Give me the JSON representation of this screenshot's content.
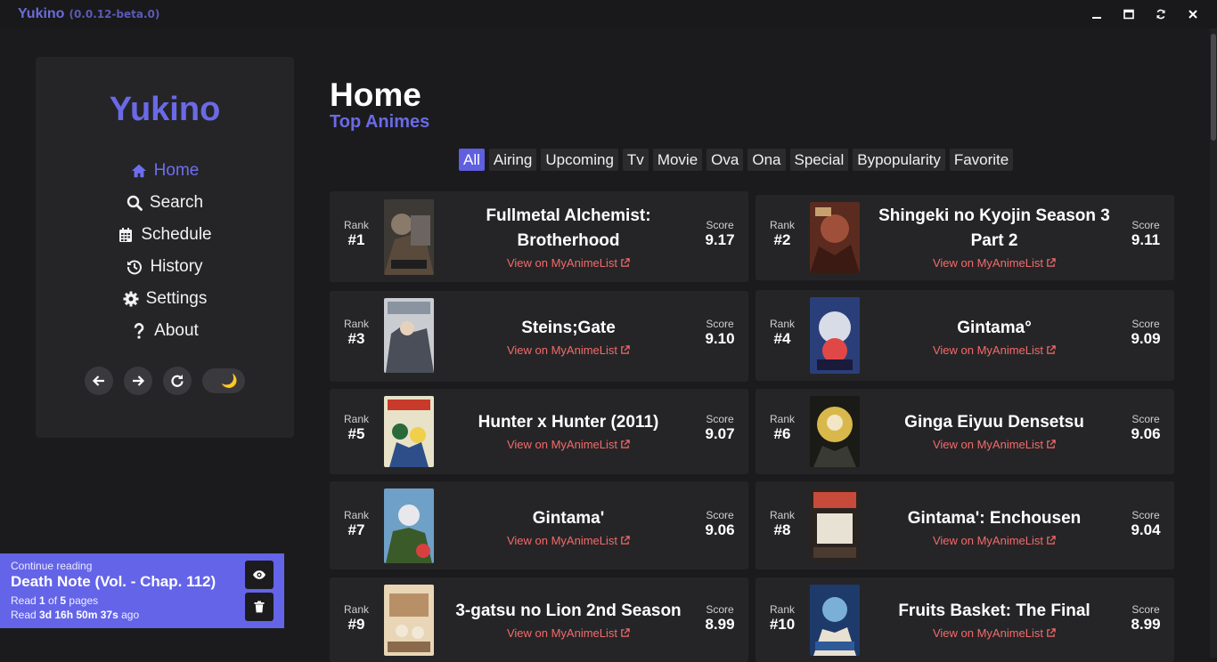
{
  "window": {
    "app_name": "Yukino",
    "version": "(0.0.12-beta.0)",
    "controls": [
      "minimize-icon",
      "maximize-icon",
      "reload-icon",
      "close-icon"
    ]
  },
  "sidebar": {
    "brand": "Yukino",
    "items": [
      {
        "label": "Home",
        "icon": "home-icon",
        "active": true
      },
      {
        "label": "Search",
        "icon": "search-icon",
        "active": false
      },
      {
        "label": "Schedule",
        "icon": "calendar-icon",
        "active": false
      },
      {
        "label": "History",
        "icon": "history-icon",
        "active": false
      },
      {
        "label": "Settings",
        "icon": "gear-icon",
        "active": false
      },
      {
        "label": "About",
        "icon": "question-icon",
        "active": false
      }
    ],
    "theme_icon": "🌙"
  },
  "header": {
    "title": "Home",
    "subtitle": "Top Animes"
  },
  "filters": [
    "All",
    "Airing",
    "Upcoming",
    "Tv",
    "Movie",
    "Ova",
    "Ona",
    "Special",
    "Bypopularity",
    "Favorite"
  ],
  "active_filter": "All",
  "labels": {
    "rank": "Rank",
    "score": "Score",
    "link": "View on MyAnimeList"
  },
  "animes": [
    {
      "rank": "#1",
      "title": "Fullmetal Alchemist: Brotherhood",
      "score": "9.17"
    },
    {
      "rank": "#2",
      "title": "Shingeki no Kyojin Season 3 Part 2",
      "score": "9.11"
    },
    {
      "rank": "#3",
      "title": "Steins;Gate",
      "score": "9.10"
    },
    {
      "rank": "#4",
      "title": "Gintama°",
      "score": "9.09"
    },
    {
      "rank": "#5",
      "title": "Hunter x Hunter (2011)",
      "score": "9.07"
    },
    {
      "rank": "#6",
      "title": "Ginga Eiyuu Densetsu",
      "score": "9.06"
    },
    {
      "rank": "#7",
      "title": "Gintama'",
      "score": "9.06"
    },
    {
      "rank": "#8",
      "title": "Gintama': Enchousen",
      "score": "9.04"
    },
    {
      "rank": "#9",
      "title": "3-gatsu no Lion 2nd Season",
      "score": "8.99"
    },
    {
      "rank": "#10",
      "title": "Fruits Basket: The Final",
      "score": "8.99"
    }
  ],
  "continue_reading": {
    "label": "Continue reading",
    "title": "Death Note (Vol. - Chap. 112)",
    "read_prefix": "Read ",
    "current_page": "1",
    "of_text": " of ",
    "total_pages": "5",
    "pages_suffix": " pages",
    "ago_prefix": "Read ",
    "elapsed": "3d 16h 50m 37s",
    "ago_suffix": " ago"
  },
  "colors": {
    "accent": "#5f5fe0",
    "link": "#f46a6a",
    "background": "#1b1b1d",
    "card": "#252527"
  }
}
